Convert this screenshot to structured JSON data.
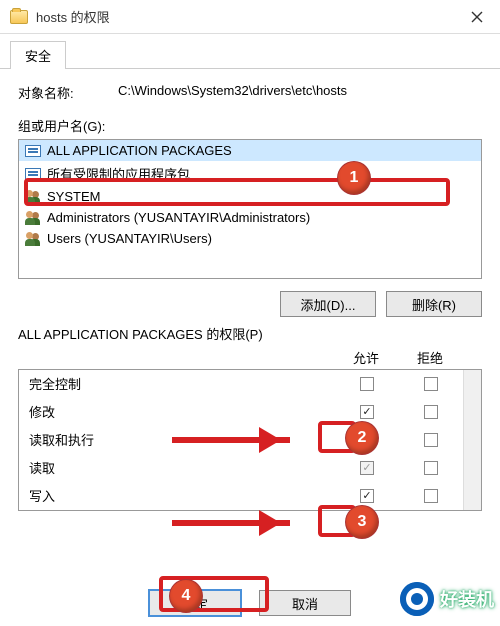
{
  "window": {
    "title": "hosts 的权限"
  },
  "tab": {
    "security": "安全"
  },
  "object": {
    "label": "对象名称:",
    "path": "C:\\Windows\\System32\\drivers\\etc\\hosts"
  },
  "groups": {
    "label": "组或用户名(G):",
    "items": [
      {
        "name": "ALL APPLICATION PACKAGES",
        "icon": "pkg",
        "selected": true
      },
      {
        "name": "所有受限制的应用程序包",
        "icon": "pkg",
        "selected": false
      },
      {
        "name": "SYSTEM",
        "icon": "users",
        "selected": false
      },
      {
        "name": "Administrators (YUSANTAYIR\\Administrators)",
        "icon": "users",
        "selected": false
      },
      {
        "name": "Users (YUSANTAYIR\\Users)",
        "icon": "users",
        "selected": false
      }
    ]
  },
  "buttons": {
    "add": "添加(D)...",
    "remove": "删除(R)",
    "ok": "确定",
    "cancel": "取消"
  },
  "perm": {
    "header_label": "ALL APPLICATION PACKAGES 的权限(P)",
    "allow": "允许",
    "deny": "拒绝",
    "rows": [
      {
        "name": "完全控制",
        "allow": "off",
        "deny": "off"
      },
      {
        "name": "修改",
        "allow": "on",
        "deny": "off"
      },
      {
        "name": "读取和执行",
        "allow": "on-dis",
        "deny": "off"
      },
      {
        "name": "读取",
        "allow": "on-dis",
        "deny": "off"
      },
      {
        "name": "写入",
        "allow": "on",
        "deny": "off"
      }
    ]
  },
  "watermark": {
    "text": "好装机"
  },
  "annotations": {
    "b1": "1",
    "b2": "2",
    "b3": "3",
    "b4": "4"
  }
}
